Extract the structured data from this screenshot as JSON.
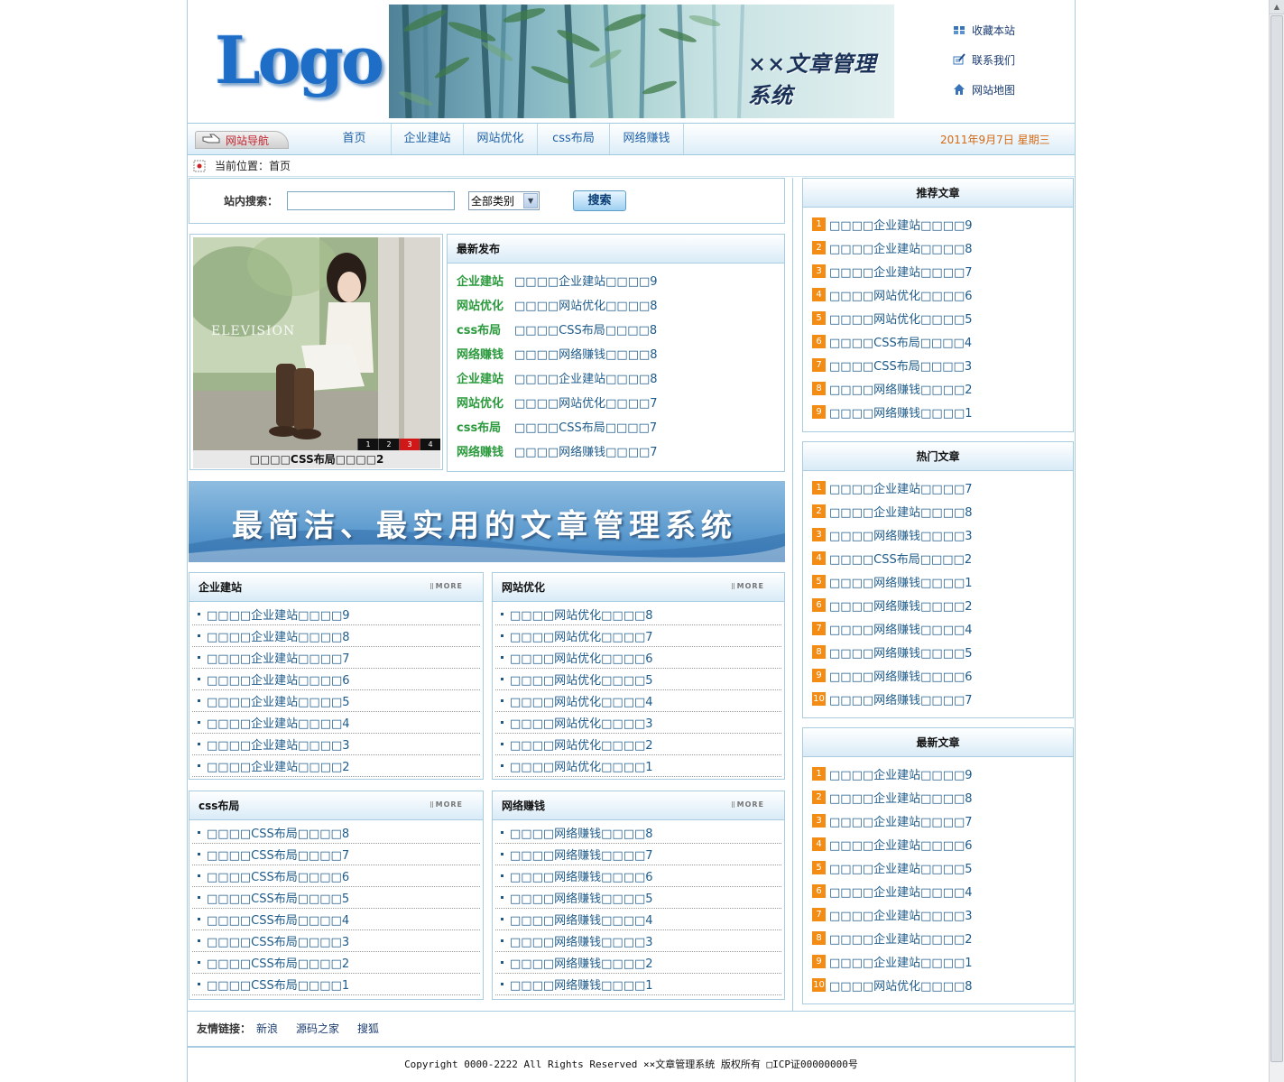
{
  "header": {
    "logo_text": "Logo",
    "banner_title": "××文章管理系统",
    "links": [
      {
        "label": "收藏本站",
        "icon": "favorite-icon"
      },
      {
        "label": "联系我们",
        "icon": "contact-icon"
      },
      {
        "label": "网站地图",
        "icon": "home-icon"
      }
    ]
  },
  "nav": {
    "tab_label": "网站导航",
    "items": [
      "首页",
      "企业建站",
      "网站优化",
      "css布局",
      "网络赚钱"
    ],
    "date": "2011年9月7日  星期三"
  },
  "location": {
    "text": "当前位置：首页"
  },
  "search": {
    "label": "站内搜索：",
    "input_value": "",
    "category_selected": "全部类别",
    "button_label": "搜索"
  },
  "slideshow": {
    "watermark": "ELEVISION",
    "numbers": [
      "1",
      "2",
      "3",
      "4"
    ],
    "active": 3,
    "caption": "□□□□CSS布局□□□□2"
  },
  "latest_publish": {
    "title": "最新发布",
    "rows": [
      {
        "cat": "企业建站",
        "title": "□□□□企业建站□□□□9"
      },
      {
        "cat": "网站优化",
        "title": "□□□□网站优化□□□□8"
      },
      {
        "cat": "css布局",
        "title": "□□□□CSS布局□□□□8"
      },
      {
        "cat": "网络赚钱",
        "title": "□□□□网络赚钱□□□□8"
      },
      {
        "cat": "企业建站",
        "title": "□□□□企业建站□□□□8"
      },
      {
        "cat": "网站优化",
        "title": "□□□□网站优化□□□□7"
      },
      {
        "cat": "css布局",
        "title": "□□□□CSS布局□□□□7"
      },
      {
        "cat": "网络赚钱",
        "title": "□□□□网络赚钱□□□□7"
      }
    ]
  },
  "promo": {
    "text": "最简洁、最实用的文章管理系统"
  },
  "more_label": "MORE",
  "categories": [
    {
      "title": "企业建站",
      "items": [
        "□□□□企业建站□□□□9",
        "□□□□企业建站□□□□8",
        "□□□□企业建站□□□□7",
        "□□□□企业建站□□□□6",
        "□□□□企业建站□□□□5",
        "□□□□企业建站□□□□4",
        "□□□□企业建站□□□□3",
        "□□□□企业建站□□□□2"
      ]
    },
    {
      "title": "网站优化",
      "items": [
        "□□□□网站优化□□□□8",
        "□□□□网站优化□□□□7",
        "□□□□网站优化□□□□6",
        "□□□□网站优化□□□□5",
        "□□□□网站优化□□□□4",
        "□□□□网站优化□□□□3",
        "□□□□网站优化□□□□2",
        "□□□□网站优化□□□□1"
      ]
    },
    {
      "title": "css布局",
      "items": [
        "□□□□CSS布局□□□□8",
        "□□□□CSS布局□□□□7",
        "□□□□CSS布局□□□□6",
        "□□□□CSS布局□□□□5",
        "□□□□CSS布局□□□□4",
        "□□□□CSS布局□□□□3",
        "□□□□CSS布局□□□□2",
        "□□□□CSS布局□□□□1"
      ]
    },
    {
      "title": "网络赚钱",
      "items": [
        "□□□□网络赚钱□□□□8",
        "□□□□网络赚钱□□□□7",
        "□□□□网络赚钱□□□□6",
        "□□□□网络赚钱□□□□5",
        "□□□□网络赚钱□□□□4",
        "□□□□网络赚钱□□□□3",
        "□□□□网络赚钱□□□□2",
        "□□□□网络赚钱□□□□1"
      ]
    }
  ],
  "sidebar": {
    "recommended": {
      "title": "推荐文章",
      "items": [
        "□□□□企业建站□□□□9",
        "□□□□企业建站□□□□8",
        "□□□□企业建站□□□□7",
        "□□□□网站优化□□□□6",
        "□□□□网站优化□□□□5",
        "□□□□CSS布局□□□□4",
        "□□□□CSS布局□□□□3",
        "□□□□网络赚钱□□□□2",
        "□□□□网络赚钱□□□□1"
      ]
    },
    "hot": {
      "title": "热门文章",
      "items": [
        "□□□□企业建站□□□□7",
        "□□□□企业建站□□□□8",
        "□□□□网络赚钱□□□□3",
        "□□□□CSS布局□□□□2",
        "□□□□网络赚钱□□□□1",
        "□□□□网络赚钱□□□□2",
        "□□□□网络赚钱□□□□4",
        "□□□□网络赚钱□□□□5",
        "□□□□网络赚钱□□□□6",
        "□□□□网络赚钱□□□□7"
      ]
    },
    "newest": {
      "title": "最新文章",
      "items": [
        "□□□□企业建站□□□□9",
        "□□□□企业建站□□□□8",
        "□□□□企业建站□□□□7",
        "□□□□企业建站□□□□6",
        "□□□□企业建站□□□□5",
        "□□□□企业建站□□□□4",
        "□□□□企业建站□□□□3",
        "□□□□企业建站□□□□2",
        "□□□□企业建站□□□□1",
        "□□□□网站优化□□□□8"
      ]
    }
  },
  "friends": {
    "label": "友情链接：",
    "links": [
      "新浪",
      "源码之家",
      "搜狐"
    ]
  },
  "footer": {
    "text": "Copyright 0000-2222 All Rights Reserved  ××文章管理系统 版权所有 □ICP证00000000号"
  },
  "colors": {
    "border": "#a9cde0",
    "link": "#1e5b8a",
    "category_green": "#2a9a3c",
    "rank_orange": "#f28c15",
    "date_orange": "#d26a16"
  }
}
